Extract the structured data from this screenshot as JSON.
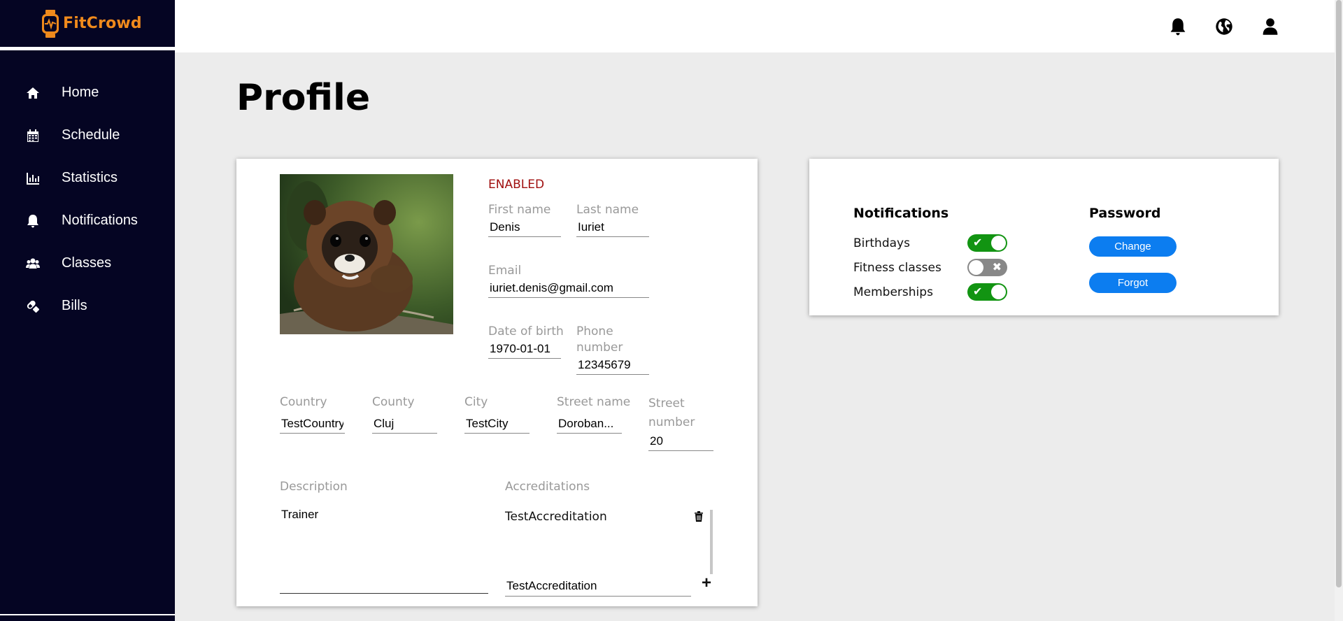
{
  "app": {
    "name": "FitCrowd"
  },
  "sidebar": {
    "items": [
      {
        "label": "Home",
        "icon": "home-icon"
      },
      {
        "label": "Schedule",
        "icon": "calendar-icon"
      },
      {
        "label": "Statistics",
        "icon": "bar-chart-icon"
      },
      {
        "label": "Notifications",
        "icon": "bell-icon"
      },
      {
        "label": "Classes",
        "icon": "users-icon"
      },
      {
        "label": "Bills",
        "icon": "pill-icon"
      }
    ]
  },
  "topbar": {
    "icons": [
      "bell-icon",
      "globe-icon",
      "user-icon"
    ]
  },
  "page": {
    "title": "Profile"
  },
  "profile": {
    "status": "ENABLED",
    "first_name": {
      "label": "First name",
      "value": "Denis"
    },
    "last_name": {
      "label": "Last name",
      "value": "Iuriet"
    },
    "email": {
      "label": "Email",
      "value": "iuriet.denis@gmail.com"
    },
    "dob": {
      "label": "Date of birth",
      "value": "1970-01-01"
    },
    "phone": {
      "label": "Phone number",
      "value": "12345679"
    },
    "country": {
      "label": "Country",
      "value": "TestCountry"
    },
    "county": {
      "label": "County",
      "value": "Cluj"
    },
    "city": {
      "label": "City",
      "value": "TestCity"
    },
    "street_name": {
      "label": "Street name",
      "value": "Doroban..."
    },
    "street_number": {
      "label": "Street number",
      "value": "20"
    },
    "description": {
      "label": "Description",
      "value": "Trainer"
    },
    "accreditations": {
      "label": "Accreditations",
      "items": [
        "TestAccreditation"
      ],
      "new_value": "TestAccreditation"
    }
  },
  "settings": {
    "notifications": {
      "title": "Notifications",
      "items": [
        {
          "label": "Birthdays",
          "enabled": true
        },
        {
          "label": "Fitness classes",
          "enabled": false
        },
        {
          "label": "Memberships",
          "enabled": true
        }
      ]
    },
    "password": {
      "title": "Password",
      "change_label": "Change",
      "forgot_label": "Forgot"
    }
  },
  "colors": {
    "sidebar_bg": "#050523",
    "brand": "#f08a1c",
    "status_enabled": "#a01010",
    "toggle_on": "#129412",
    "toggle_off": "#888888",
    "button_primary": "#0c7df0"
  }
}
